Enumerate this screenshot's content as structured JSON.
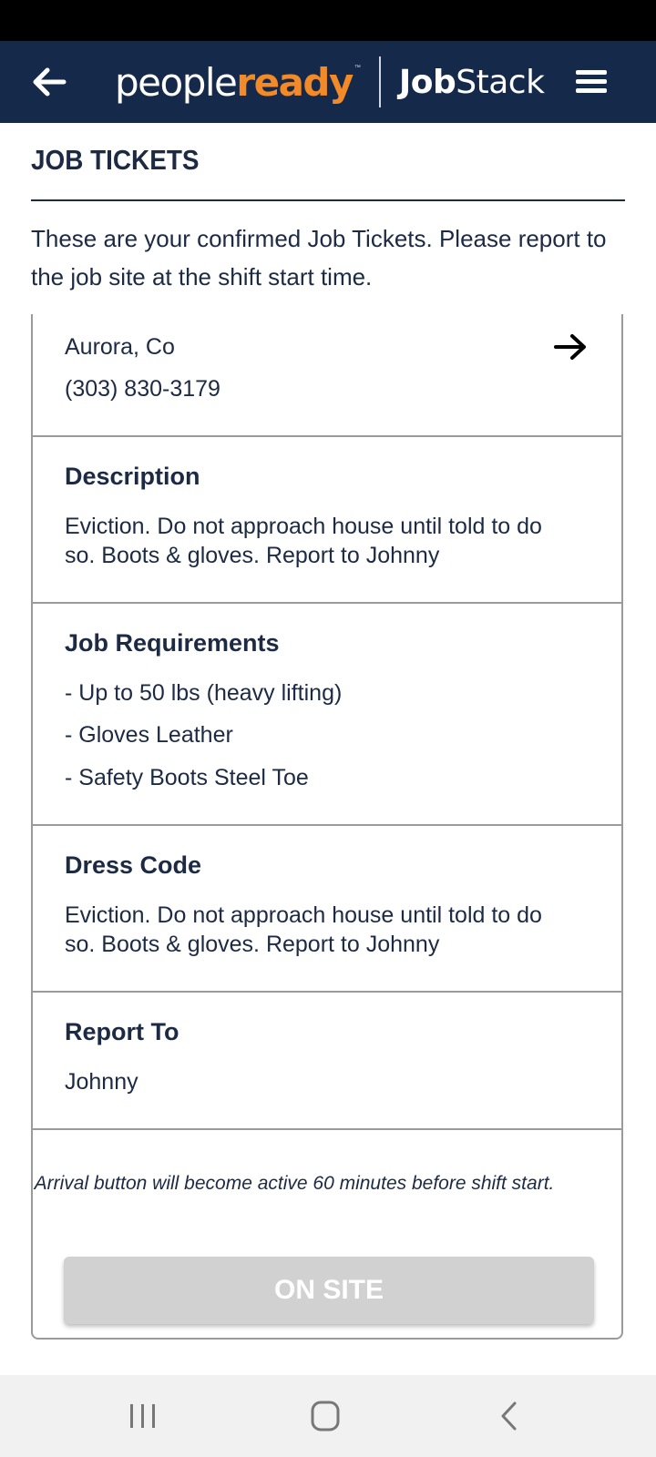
{
  "header": {
    "logo_people": "people",
    "logo_ready": "ready",
    "logo_tm": "™",
    "logo_job": "Job",
    "logo_stack": "Stack",
    "brand_colors": {
      "navy": "#15294b",
      "orange": "#f28a28"
    },
    "back_icon": "arrow-left-icon",
    "menu_icon": "hamburger-menu-icon"
  },
  "page": {
    "title": "JOB TICKETS",
    "intro": "These are your confirmed Job Tickets. Please report to the job site at the shift start time."
  },
  "ticket": {
    "location": {
      "city": "Aurora, Co",
      "phone": "(303) 830-3179",
      "directions_icon": "arrow-right-icon"
    },
    "description": {
      "title": "Description",
      "text": "Eviction. Do not approach house until told to do so. Boots & gloves. Report to Johnny"
    },
    "requirements": {
      "title": "Job Requirements",
      "items": [
        "- Up to 50 lbs (heavy lifting)",
        "- Gloves Leather",
        "- Safety Boots Steel Toe"
      ]
    },
    "dress_code": {
      "title": "Dress Code",
      "text": "Eviction. Do not approach house until told to do so. Boots & gloves. Report to Johnny"
    },
    "report_to": {
      "title": "Report To",
      "name": "Johnny"
    },
    "arrival_note": "Arrival button will become active 60 minutes before shift start.",
    "on_site_label": "ON SITE"
  },
  "system_nav": {
    "recents_icon": "recents-icon",
    "home_icon": "home-icon",
    "back_icon": "back-chevron-icon"
  }
}
